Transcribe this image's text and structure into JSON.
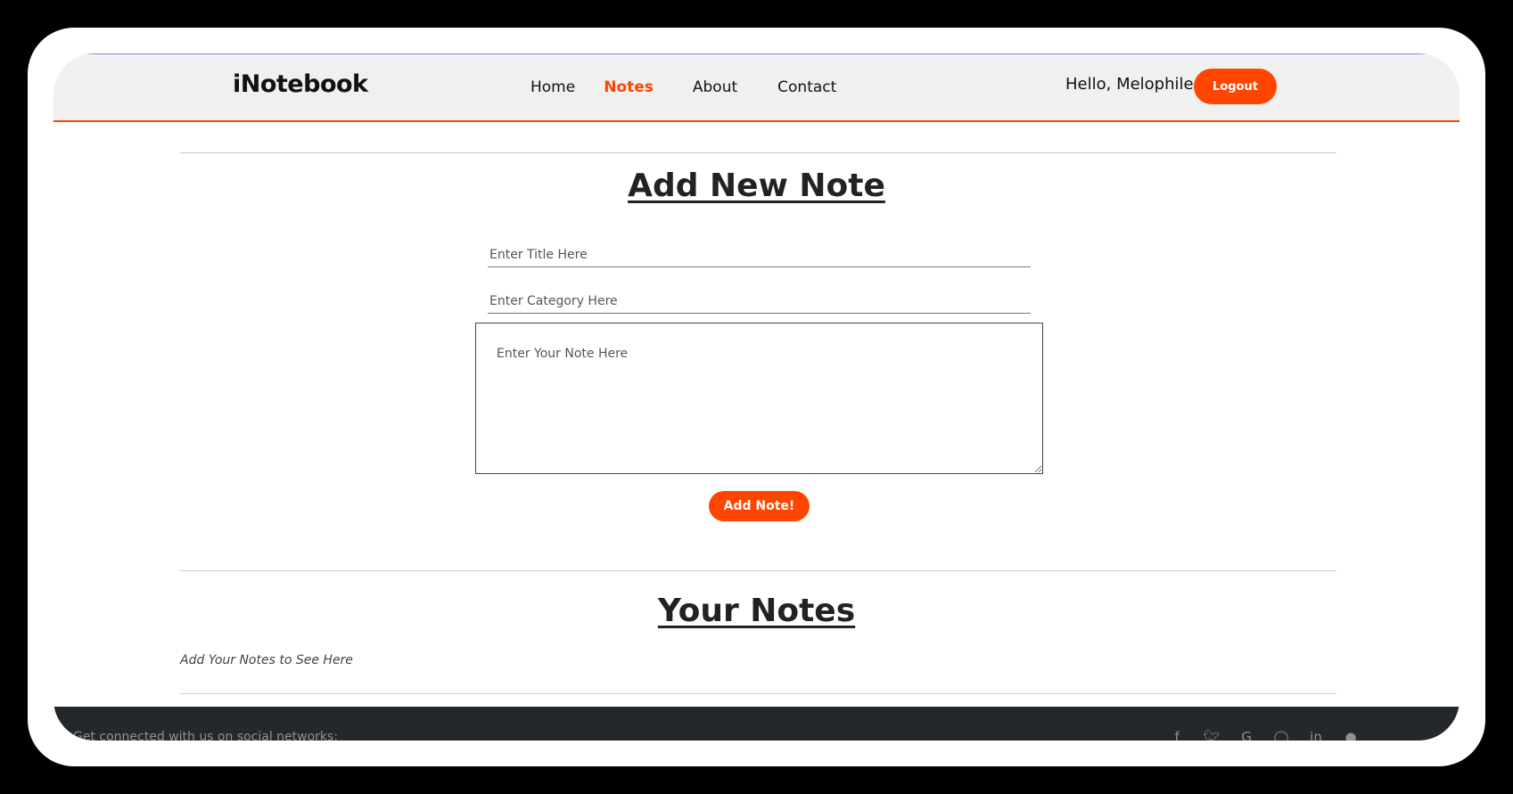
{
  "navbar": {
    "brand": "iNotebook",
    "links": [
      {
        "label": "Home",
        "active": false
      },
      {
        "label": "Notes",
        "active": true
      },
      {
        "label": "About",
        "active": false
      },
      {
        "label": "Contact",
        "active": false
      }
    ],
    "greeting": "Hello, Melophile",
    "logout_label": "Logout"
  },
  "add_note": {
    "heading": "Add New Note",
    "title_placeholder": "Enter Title Here",
    "category_placeholder": "Enter Category Here",
    "note_placeholder": "Enter Your Note Here",
    "submit_label": "Add Note!"
  },
  "your_notes": {
    "heading": "Your Notes",
    "empty_message": "Add Your Notes to See Here"
  },
  "footer": {
    "text": "Get connected with us on social networks:",
    "social_icons": [
      "facebook-icon",
      "twitter-icon",
      "google-icon",
      "instagram-icon",
      "linkedin-icon",
      "github-icon"
    ]
  },
  "colors": {
    "accent": "#ff4500",
    "navbar_bg": "#f0f0f0",
    "footer_bg": "#24272b"
  }
}
